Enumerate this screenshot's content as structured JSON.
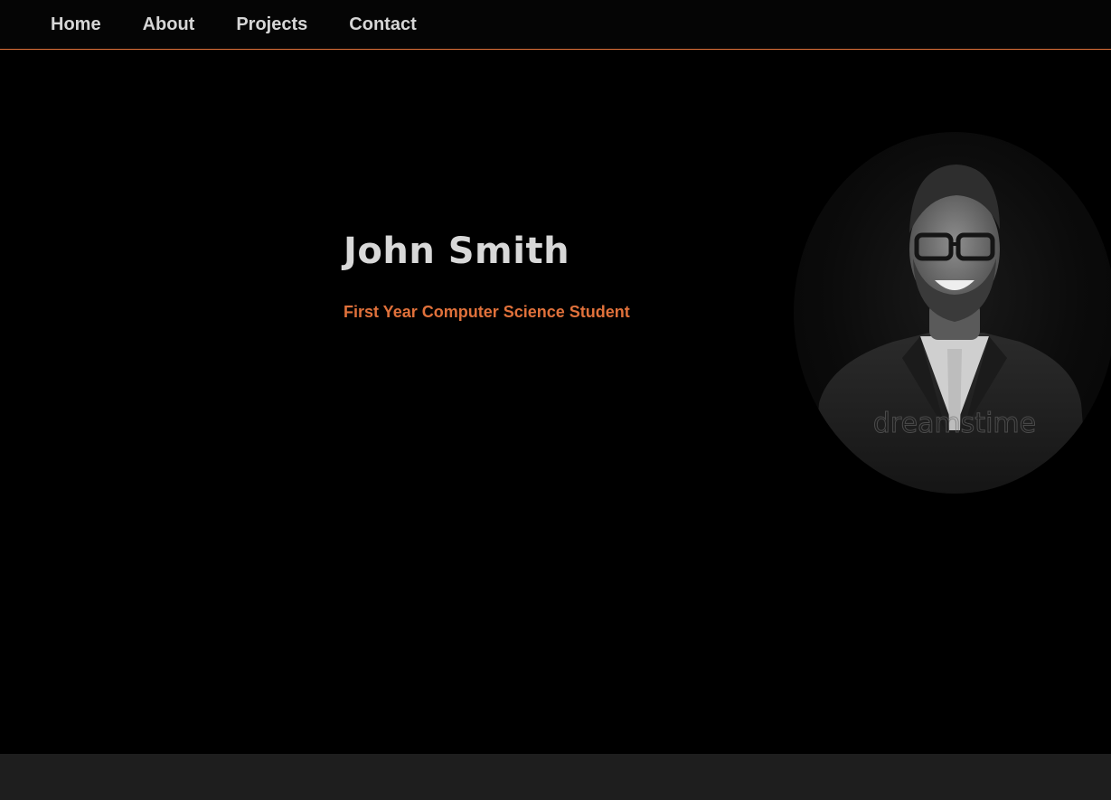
{
  "nav": {
    "items": [
      {
        "label": "Home"
      },
      {
        "label": "About"
      },
      {
        "label": "Projects"
      },
      {
        "label": "Contact"
      }
    ]
  },
  "hero": {
    "name": "John Smith",
    "subtitle": "First Year Computer Science Student",
    "photo": {
      "subject": "portrait-photo",
      "watermark": "dreamstime"
    }
  },
  "colors": {
    "accent": "#e0713b",
    "text": "#d8d8d8",
    "background": "#000000",
    "footer": "#1e1e1e"
  }
}
